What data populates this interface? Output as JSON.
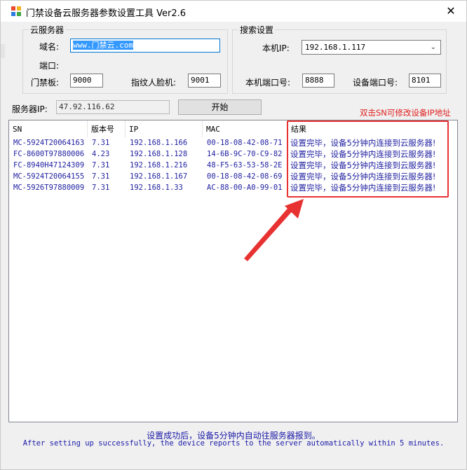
{
  "window": {
    "title": "门禁设备云服务器参数设置工具 Ver2.6",
    "close_glyph": "✕"
  },
  "cloud_group": {
    "title": "云服务器",
    "domain_label": "域名:",
    "domain_value": "www.门禁云.com",
    "port_label": "端口:",
    "access_label": "门禁板:",
    "access_port": "9000",
    "face_label": "指纹人脸机:",
    "face_port": "9001"
  },
  "search_group": {
    "title": "搜索设置",
    "local_ip_label": "本机IP:",
    "local_ip_value": "192.168.1.117",
    "local_port_label": "本机端口号:",
    "local_port_value": "8888",
    "device_port_label": "设备端口号:",
    "device_port_value": "8101"
  },
  "server_ip": {
    "label": "服务器IP:",
    "value": "47.92.116.62"
  },
  "start_button": "开始",
  "hint": "双击SN可修改设备IP地址",
  "table": {
    "columns": [
      "SN",
      "版本号",
      "IP",
      "MAC",
      "结果"
    ],
    "rows": [
      [
        "MC-5924T20064163",
        "7.31",
        "192.168.1.166",
        "00-18-08-42-08-71",
        "设置完毕，设备5分钟内连接到云服务器!"
      ],
      [
        "FC-8600T97880006",
        "4.23",
        "192.168.1.128",
        "14-6B-9C-70-C9-82",
        "设置完毕，设备5分钟内连接到云服务器!"
      ],
      [
        "FC-8940H47124309",
        "7.31",
        "192.168.1.216",
        "48-F5-63-53-58-2E",
        "设置完毕，设备5分钟内连接到云服务器!"
      ],
      [
        "MC-5924T20064155",
        "7.31",
        "192.168.1.167",
        "00-18-08-42-08-69",
        "设置完毕，设备5分钟内连接到云服务器!"
      ],
      [
        "MC-5926T97880009",
        "7.31",
        "192.168.1.33",
        "AC-88-00-A0-99-01",
        "设置完毕，设备5分钟内连接到云服务器!"
      ]
    ]
  },
  "footer": {
    "line_cn": "设置成功后，设备5分钟内自动往服务器报到。",
    "line_en": "After setting up successfully, the device reports to the server automatically within 5 minutes."
  },
  "colors": {
    "annotation_red": "#e83232",
    "row_text": "#1f1fa0",
    "selection": "#3399ff"
  },
  "icons": {
    "app": "door-access-app-icon",
    "dropdown": "chevron-down-icon",
    "annotation": "red-arrow"
  }
}
